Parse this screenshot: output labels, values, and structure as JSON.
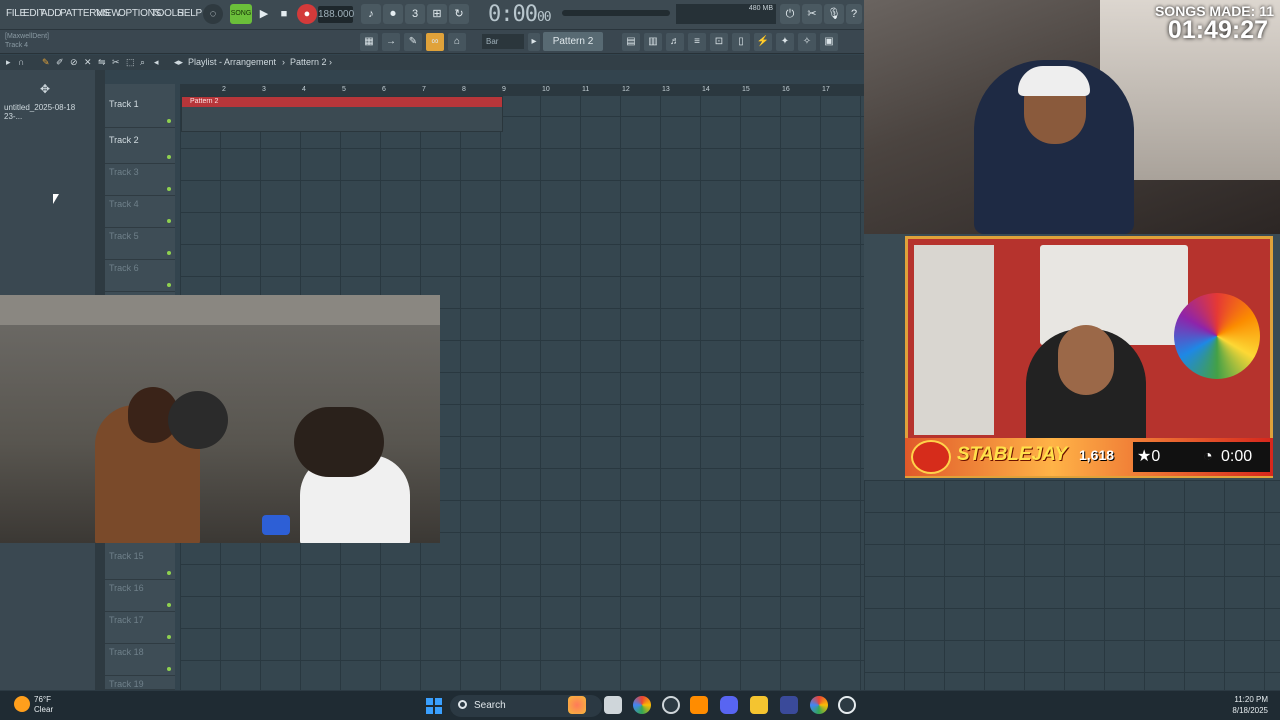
{
  "app": {
    "menus": [
      "FILE",
      "EDIT",
      "ADD",
      "PATTERNS",
      "VIEW",
      "OPTIONS",
      "TOOLS",
      "HELP"
    ],
    "song_mode_label": "SONG",
    "bpm": "188.000",
    "time_display": "0:00",
    "time_sub": "00",
    "memory": "480 MB",
    "hint_line1": "[MaxwellDent]",
    "hint_line2": "Track 4",
    "snap_value": "Bar",
    "pattern_selector": "Pattern 2",
    "breadcrumb": [
      "Playlist - Arrangement",
      "Pattern 2"
    ]
  },
  "browser": {
    "item": "untitled_2025-08-18 23-..."
  },
  "playlist": {
    "ruler": [
      "2",
      "3",
      "4",
      "5",
      "6",
      "7",
      "8",
      "9",
      "10",
      "11",
      "12",
      "13",
      "14",
      "15",
      "16",
      "17"
    ],
    "clip_label": "Pattern 2",
    "tracks": [
      {
        "name": "Track 1",
        "active": true
      },
      {
        "name": "Track 2",
        "active": true
      },
      {
        "name": "Track 3",
        "active": false
      },
      {
        "name": "Track 4",
        "active": false
      },
      {
        "name": "Track 5",
        "active": false
      },
      {
        "name": "Track 6",
        "active": false
      }
    ],
    "lower_tracks": [
      {
        "name": "Track 15"
      },
      {
        "name": "Track 16"
      },
      {
        "name": "Track 17"
      },
      {
        "name": "Track 18"
      },
      {
        "name": "Track 19"
      }
    ]
  },
  "overlay": {
    "songs_made_label": "SONGS MADE: 11",
    "timer": "01:49:27",
    "streamer_name": "STABLEJAY",
    "follower_count": "1,618",
    "stars": "★0",
    "clock_value": "0:00"
  },
  "taskbar": {
    "weather_temp": "76°F",
    "weather_desc": "Clear",
    "search_label": "Search",
    "time": "11:20 PM",
    "date": "8/18/2025"
  },
  "colors": {
    "playlist_bg": "#35464f",
    "clip_bar": "#b7363a",
    "accent_green": "#8fd14f"
  }
}
